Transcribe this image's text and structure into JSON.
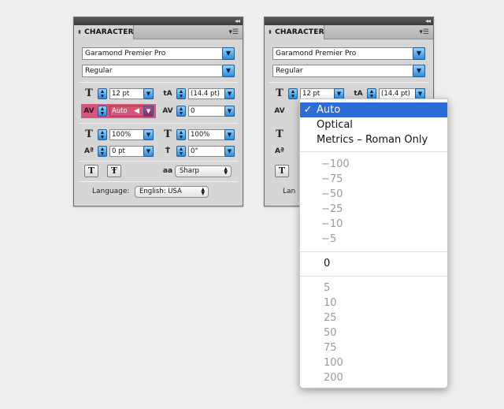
{
  "panel": {
    "title": "CHARACTER",
    "collapse_glyph": "◂◂",
    "font_family": "Garamond Premier Pro",
    "font_style": "Regular",
    "font_size": "12 pt",
    "leading": "(14.4 pt)",
    "kerning": "Auto",
    "tracking": "0",
    "vertical_scale": "100%",
    "horizontal_scale": "100%",
    "baseline_shift": "0 pt",
    "rotation": "0°",
    "antialias": "Sharp",
    "language_label": "Language:",
    "language": "English: USA",
    "highlight_color": "#d5557c"
  },
  "dropdown": {
    "options_top": [
      {
        "label": "Auto",
        "checked": true
      },
      {
        "label": "Optical"
      },
      {
        "label": "Metrics – Roman Only"
      }
    ],
    "negatives": [
      "−100",
      "−75",
      "−50",
      "−25",
      "−10",
      "−5"
    ],
    "zero": "0",
    "positives": [
      "5",
      "10",
      "25",
      "50",
      "75",
      "100",
      "200"
    ],
    "selected_color": "#2d6bd6"
  }
}
